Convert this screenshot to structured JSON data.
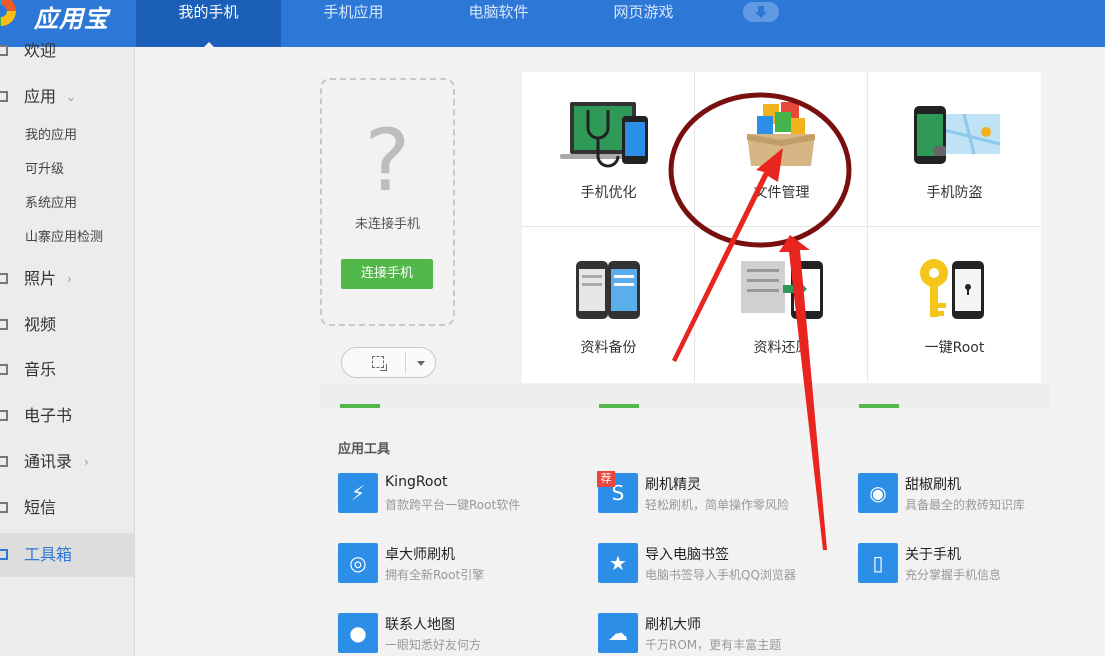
{
  "app": {
    "name": "应用宝"
  },
  "topnav": {
    "tabs": [
      {
        "label": "我的手机",
        "active": true
      },
      {
        "label": "手机应用"
      },
      {
        "label": "电脑软件"
      },
      {
        "label": "网页游戏"
      }
    ],
    "download_icon": "download-icon"
  },
  "sidebar": {
    "items": [
      {
        "label": "欢迎"
      },
      {
        "label": "应用"
      },
      {
        "label": "照片"
      },
      {
        "label": "视频"
      },
      {
        "label": "音乐"
      },
      {
        "label": "电子书"
      },
      {
        "label": "通讯录"
      },
      {
        "label": "短信"
      },
      {
        "label": "工具箱",
        "active": true
      }
    ],
    "app_subitems": [
      "我的应用",
      "可升级",
      "系统应用",
      "山寨应用检测"
    ]
  },
  "phone": {
    "placeholder_glyph": "?",
    "status": "未连接手机",
    "connect_label": "连接手机"
  },
  "tools": [
    {
      "label": "手机优化",
      "icon": "stethoscope-phone-icon"
    },
    {
      "label": "文件管理",
      "icon": "file-box-icon"
    },
    {
      "label": "手机防盗",
      "icon": "phone-lock-map-icon"
    },
    {
      "label": "资料备份",
      "icon": "phone-backup-icon"
    },
    {
      "label": "资料还原",
      "icon": "phone-restore-icon"
    },
    {
      "label": "一键Root",
      "icon": "key-phone-icon"
    }
  ],
  "section": {
    "title": "应用工具"
  },
  "apps": [
    {
      "name": "KingRoot",
      "desc": "首款跨平台一键Root软件",
      "icon": "lightning-icon"
    },
    {
      "name": "刷机精灵",
      "desc": "轻松刷机，简单操作零风险",
      "icon": "shield-s-icon",
      "badge": "荐"
    },
    {
      "name": "甜椒刷机",
      "desc": "具备最全的救砖知识库",
      "icon": "pepper-icon"
    },
    {
      "name": "卓大师刷机",
      "desc": "拥有全新Root引擎",
      "icon": "globe-icon"
    },
    {
      "name": "导入电脑书签",
      "desc": "电脑书签导入手机QQ浏览器",
      "icon": "bookmark-icon"
    },
    {
      "name": "关于手机",
      "desc": "充分掌握手机信息",
      "icon": "phone-info-icon"
    },
    {
      "name": "联系人地图",
      "desc": "一眼知悉好友何方",
      "icon": "map-pin-icon"
    },
    {
      "name": "刷机大师",
      "desc": "千万ROM，更有丰富主题",
      "icon": "cloud-icon"
    }
  ],
  "colors": {
    "accent": "#2d78d6",
    "green": "#52b84a",
    "annotation": "#e8261f",
    "circle": "#7a0f0f"
  }
}
